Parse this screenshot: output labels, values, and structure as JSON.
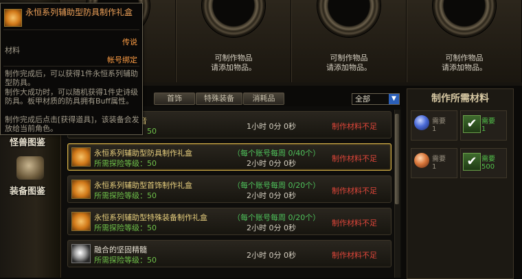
{
  "slots": [
    {
      "line1": "",
      "line2": ""
    },
    {
      "line1": "可制作物品",
      "line2": "请添加物品。"
    },
    {
      "line1": "可制作物品",
      "line2": "请添加物品。"
    },
    {
      "line1": "可制作物品",
      "line2": "请添加物品。"
    }
  ],
  "tabs": [
    "首饰",
    "特殊装备",
    "消耗品"
  ],
  "filter": {
    "value": "全部"
  },
  "sidebar": [
    {
      "label": "怪兽图鉴"
    },
    {
      "label": "装备图鉴"
    }
  ],
  "tooltip": {
    "title": "永恒系列辅助型防具制作礼盒",
    "rarity": "传说",
    "type": "材料",
    "bind": "帐号绑定",
    "desc1": "制作完成后，可以获得1件永恒系列辅助型防具。",
    "desc2": "制作大成功时，可以随机获得1件史诗级防具。板甲材质的防具拥有Buff属性。",
    "desc3": "制作完成后点击[获得道具]，该装备会发放给当前角色。"
  },
  "list": [
    {
      "name": "音",
      "level": "：50",
      "limit": "",
      "time": "1小时 0分 0秒",
      "status": "制作材料不足",
      "icon": "box-icon"
    },
    {
      "name": "永恒系列辅助型防具制作礼盒",
      "level": "所需探险等级：50",
      "limit": "（每个账号每周 0/40个）",
      "time": "2小时 0分 0秒",
      "status": "制作材料不足",
      "icon": "box-icon"
    },
    {
      "name": "永恒系列辅助型首饰制作礼盒",
      "level": "所需探险等级：50",
      "limit": "（每个账号每周 0/20个）",
      "time": "2小时 0分 0秒",
      "status": "制作材料不足",
      "icon": "box-icon"
    },
    {
      "name": "永恒系列辅助型特殊装备制作礼盒",
      "level": "所需探险等级：50",
      "limit": "（每个账号每周 0/20个）",
      "time": "2小时 0分 0秒",
      "status": "制作材料不足",
      "icon": "box-icon"
    },
    {
      "name": "融合的坚固精髓",
      "level": "所需探险等级：50",
      "limit": "",
      "time": "2小时 0分 0秒",
      "status": "制作材料不足",
      "icon": "stone-icon"
    }
  ],
  "materials": {
    "title": "制作所需材料",
    "items": [
      {
        "label": "需要",
        "count": "1",
        "icon": "blue-orb-icon",
        "ok": false
      },
      {
        "label": "需要",
        "count": "1",
        "icon": "check-icon",
        "ok": true
      },
      {
        "label": "需要",
        "count": "1",
        "icon": "orange-orb-icon",
        "ok": false
      },
      {
        "label": "需要",
        "count": "500",
        "icon": "check-icon",
        "ok": true
      }
    ]
  }
}
